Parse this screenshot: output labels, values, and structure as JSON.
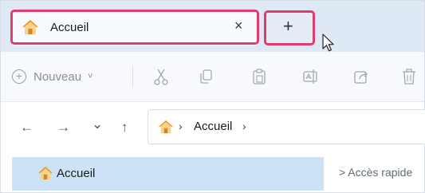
{
  "tab": {
    "title": "Accueil",
    "close_glyph": "×",
    "icon": "home-icon"
  },
  "new_tab": {
    "glyph": "+"
  },
  "toolbar": {
    "new_label": "Nouveau",
    "new_plus": "+",
    "new_chevron": "˅",
    "tools": [
      "cut-icon",
      "copy-icon",
      "paste-icon",
      "rename-icon",
      "share-icon",
      "delete-icon"
    ]
  },
  "nav": {
    "back": "←",
    "forward": "→",
    "recent": "⌄",
    "up": "↑"
  },
  "address": {
    "location": "Accueil",
    "separator": "›"
  },
  "sidebar": {
    "selected_label": "Accueil"
  },
  "content": {
    "section_label": "> Accès rapide"
  },
  "colors": {
    "highlight": "#e23b6e",
    "tabstrip": "#dfe9f5",
    "selection": "#cce3f7",
    "home_roof": "#f0921d"
  }
}
